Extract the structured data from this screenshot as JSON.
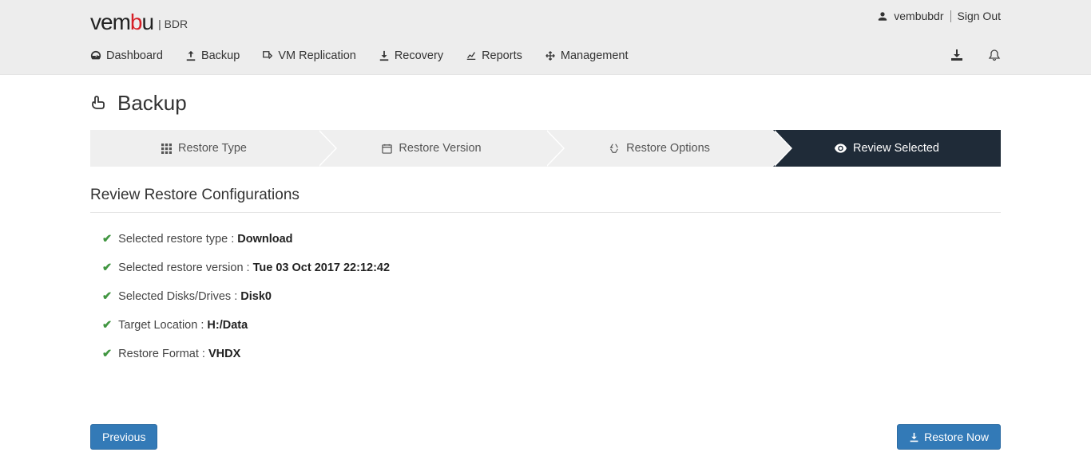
{
  "header": {
    "logo_primary": "vembu",
    "logo_suffix": "| BDR",
    "username": "vembubdr",
    "signout": "Sign Out"
  },
  "nav": {
    "items": [
      {
        "label": "Dashboard",
        "icon": "dashboard-icon"
      },
      {
        "label": "Backup",
        "icon": "upload-icon"
      },
      {
        "label": "VM Replication",
        "icon": "share-icon"
      },
      {
        "label": "Recovery",
        "icon": "download-icon"
      },
      {
        "label": "Reports",
        "icon": "chart-icon"
      },
      {
        "label": "Management",
        "icon": "move-icon"
      }
    ]
  },
  "page": {
    "title": "Backup"
  },
  "wizard": {
    "steps": [
      {
        "label": "Restore Type",
        "icon": "grid-icon"
      },
      {
        "label": "Restore Version",
        "icon": "calendar-icon"
      },
      {
        "label": "Restore Options",
        "icon": "recycle-icon"
      },
      {
        "label": "Review Selected",
        "icon": "eye-icon"
      }
    ],
    "active_index": 3
  },
  "section": {
    "title": "Review Restore Configurations"
  },
  "configs": [
    {
      "label": "Selected restore type : ",
      "value": "Download"
    },
    {
      "label": "Selected restore version : ",
      "value": "Tue 03 Oct 2017 22:12:42"
    },
    {
      "label": "Selected Disks/Drives : ",
      "value": "Disk0"
    },
    {
      "label": "Target Location : ",
      "value": "H:/Data"
    },
    {
      "label": "Restore Format : ",
      "value": "VHDX"
    }
  ],
  "buttons": {
    "previous": "Previous",
    "restore_now": "Restore Now"
  }
}
